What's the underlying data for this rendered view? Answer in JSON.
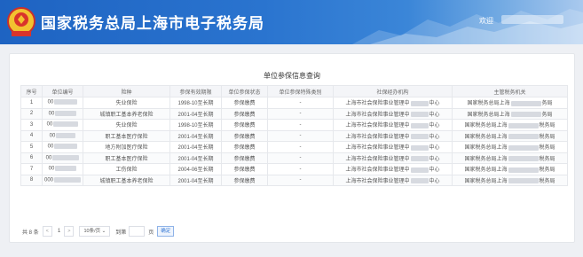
{
  "header": {
    "site_title": "国家税务总局上海市电子税务局",
    "welcome": "欢迎",
    "colors": {
      "blue": "#1e63c2",
      "light": "#a9c9ee"
    }
  },
  "panel": {
    "title": "单位参保信息查询",
    "columns": [
      "序号",
      "单位编号",
      "险种",
      "参保有效期限",
      "单位参保状态",
      "单位参保特殊类别",
      "社保经办机构",
      "主管税务机关"
    ],
    "rows": [
      {
        "no": "1",
        "unit": "00",
        "type": "失业保险",
        "period": "1998-10至长期",
        "status": "参保缴费",
        "special": "-",
        "agency_a": "上海市社会保险事业管理中",
        "agency_b": "中心",
        "tax_a": "国家税务总局上海",
        "tax_b": "务局"
      },
      {
        "no": "2",
        "unit": "00",
        "type": "城镇职工基本养老保险",
        "period": "2001-04至长期",
        "status": "参保缴费",
        "special": "-",
        "agency_a": "上海市社会保险事业管理中",
        "agency_b": "中心",
        "tax_a": "国家税务总局上海",
        "tax_b": "务局"
      },
      {
        "no": "3",
        "unit": "00",
        "type": "失业保险",
        "period": "1998-10至长期",
        "status": "参保缴费",
        "special": "-",
        "agency_a": "上海市社会保险事业管理中",
        "agency_b": "中心",
        "tax_a": "国家税务总局上海",
        "tax_b": "税务局"
      },
      {
        "no": "4",
        "unit": "00",
        "type": "职工基本医疗保险",
        "period": "2001-04至长期",
        "status": "参保缴费",
        "special": "-",
        "agency_a": "上海市社会保险事业管理中",
        "agency_b": "中心",
        "tax_a": "国家税务总局上海",
        "tax_b": "税务局"
      },
      {
        "no": "5",
        "unit": "00",
        "type": "地方附加医疗保险",
        "period": "2001-04至长期",
        "status": "参保缴费",
        "special": "-",
        "agency_a": "上海市社会保险事业管理中",
        "agency_b": "中心",
        "tax_a": "国家税务总局上海",
        "tax_b": "税务局"
      },
      {
        "no": "6",
        "unit": "00",
        "type": "职工基本医疗保险",
        "period": "2001-04至长期",
        "status": "参保缴费",
        "special": "-",
        "agency_a": "上海市社会保险事业管理中",
        "agency_b": "中心",
        "tax_a": "国家税务总局上海",
        "tax_b": "税务局"
      },
      {
        "no": "7",
        "unit": "00",
        "type": "工伤保险",
        "period": "2004-06至长期",
        "status": "参保缴费",
        "special": "-",
        "agency_a": "上海市社会保险事业管理中",
        "agency_b": "中心",
        "tax_a": "国家税务总局上海",
        "tax_b": "税务局"
      },
      {
        "no": "8",
        "unit": "000",
        "type": "城镇职工基本养老保险",
        "period": "2001-04至长期",
        "status": "参保缴费",
        "special": "-",
        "agency_a": "上海市社会保险事业管理中",
        "agency_b": "中心",
        "tax_a": "国家税务总局上海",
        "tax_b": "税务局"
      }
    ]
  },
  "pager": {
    "total": "共 8 条",
    "prev": "<",
    "page": "1",
    "next": ">",
    "page_size": "10条/页",
    "goto": "到第",
    "page_unit": "页",
    "confirm": "确定"
  }
}
